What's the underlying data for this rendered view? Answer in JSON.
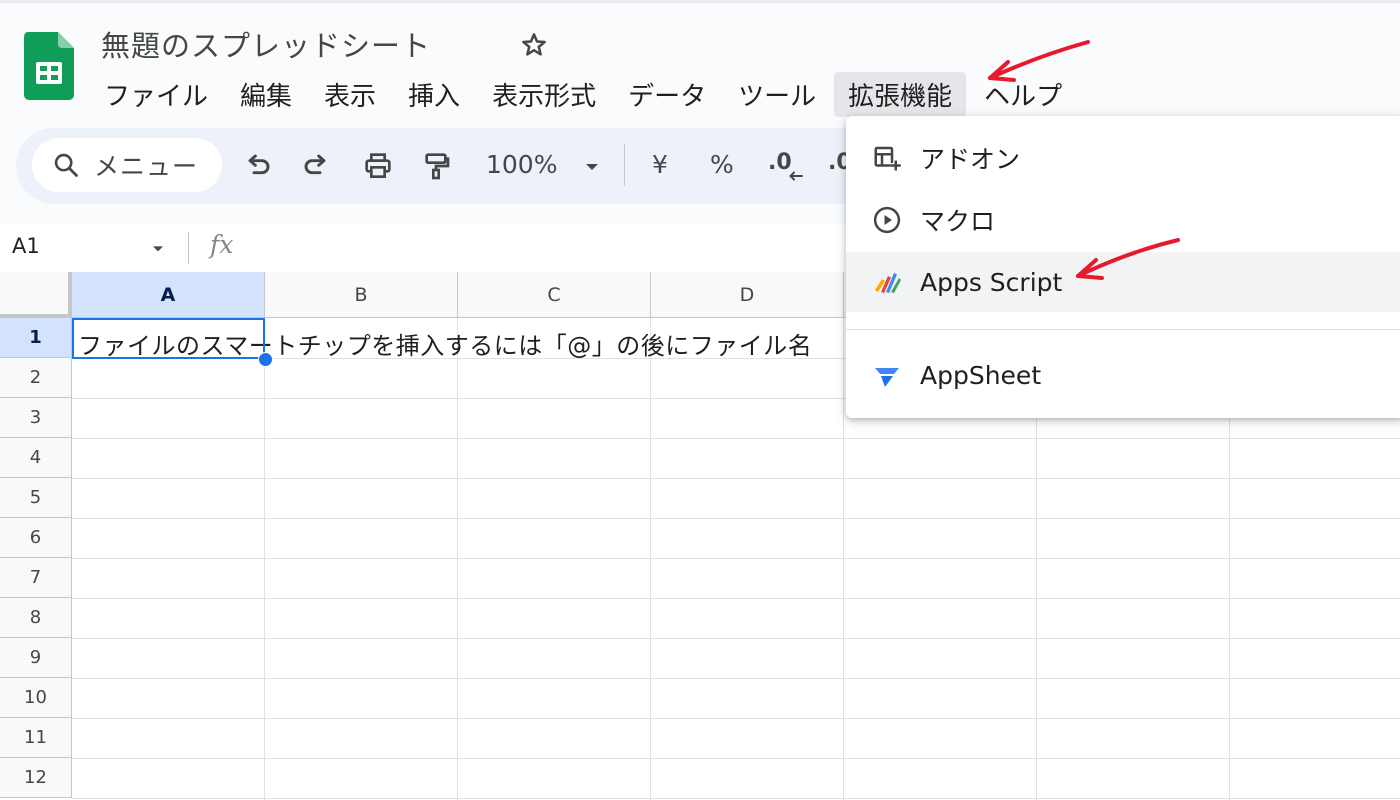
{
  "document": {
    "title": "無題のスプレッドシート"
  },
  "menubar": {
    "items": [
      {
        "label": "ファイル"
      },
      {
        "label": "編集"
      },
      {
        "label": "表示"
      },
      {
        "label": "挿入"
      },
      {
        "label": "表示形式"
      },
      {
        "label": "データ"
      },
      {
        "label": "ツール"
      },
      {
        "label": "拡張機能"
      },
      {
        "label": "ヘルプ"
      }
    ],
    "active_index": 7
  },
  "toolbar": {
    "search_label": "メニュー",
    "zoom": "100%",
    "currency": "¥",
    "percent": "%",
    "decrease_decimal": ".0",
    "increase_decimal": ".0"
  },
  "formula_bar": {
    "cell_ref": "A1",
    "fx": "fx"
  },
  "grid": {
    "columns": [
      "A",
      "B",
      "C",
      "D"
    ],
    "rows": [
      "1",
      "2",
      "3",
      "4",
      "5",
      "6",
      "7",
      "8",
      "9",
      "10",
      "11",
      "12"
    ],
    "selected_cell": "A1",
    "cell_a1_text": "ファイルのスマートチップを挿入するには「@」の後にファイル名"
  },
  "extensions_menu": {
    "items": [
      {
        "label": "アドオン",
        "icon": "addon-icon"
      },
      {
        "label": "マクロ",
        "icon": "macro-play-icon"
      },
      {
        "label": "Apps Script",
        "icon": "apps-script-icon"
      },
      {
        "label": "AppSheet",
        "icon": "appsheet-icon"
      }
    ],
    "highlighted": "Apps Script"
  },
  "colors": {
    "accent": "#1a73e8",
    "sheets_green": "#0f9d58",
    "annotation_red": "#e8192c",
    "toolbar_bg": "#edf2fa",
    "selected_header_bg": "#d3e3fd"
  }
}
